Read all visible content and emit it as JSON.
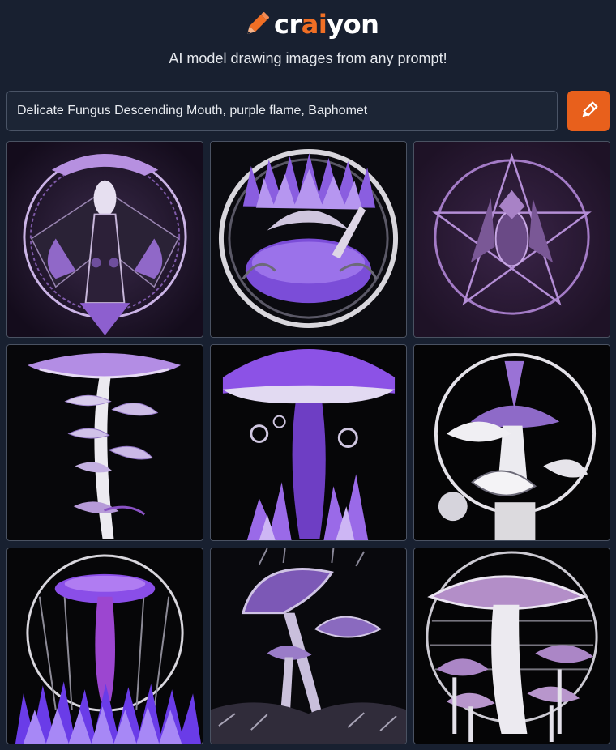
{
  "brand": {
    "name_prefix": "cr",
    "name_accent": "ai",
    "name_suffix": "yon",
    "tagline": "AI model drawing images from any prompt!",
    "logo_icon": "pencil-icon",
    "accent_color": "#f06f25"
  },
  "prompt": {
    "value": "Delicate Fungus Descending Mouth, purple flame, Baphomet",
    "placeholder": "",
    "submit_icon": "pencil-icon",
    "submit_color": "#e8601c"
  },
  "results": {
    "images": [
      {
        "subject": "baphomet winged figure in circle"
      },
      {
        "subject": "purple mushroom bowl with flames in round frame"
      },
      {
        "subject": "baphomet with pentagram"
      },
      {
        "subject": "stacked delicate purple fungus"
      },
      {
        "subject": "purple mushroom over purple flames"
      },
      {
        "subject": "white and purple mushrooms in globe"
      },
      {
        "subject": "purple mushroom with flame grass"
      },
      {
        "subject": "purple mushroom cluster on dark ground"
      },
      {
        "subject": "white and lilac mushroom cluster"
      }
    ]
  }
}
